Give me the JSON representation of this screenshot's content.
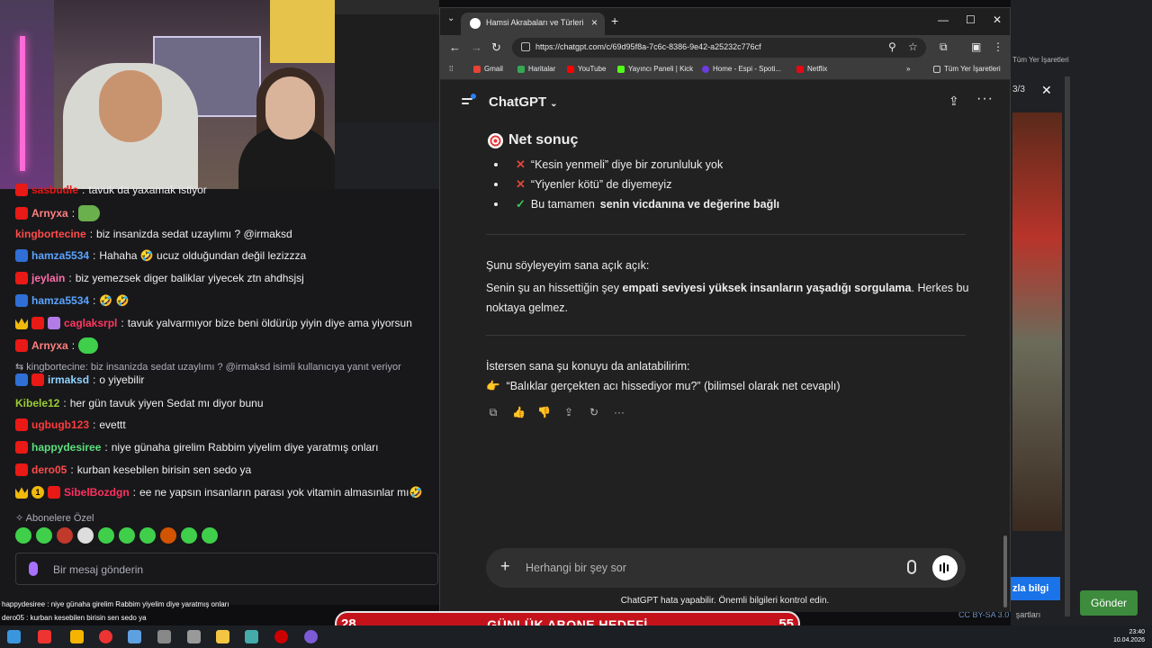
{
  "chat": {
    "lines": [
      {
        "user": "sasbudle",
        "color": "#e91916",
        "text": "tavuk da yaxamak istiyor"
      },
      {
        "user": "Arnyxa",
        "color": "#ff7f7f",
        "text": ""
      },
      {
        "user": "kingbortecine",
        "color": "#ff4b4b",
        "text": "biz insanizda sedat uzaylımı ? @irmaksd"
      },
      {
        "user": "hamza5534",
        "color": "#5ba4ff",
        "text": "Hahaha 🤣 ucuz olduğundan değil lezizzza"
      },
      {
        "user": "jeylain",
        "color": "#ff6fa8",
        "text": "biz yemezsek diger baliklar yiyecek ztn ahdhsjsj"
      },
      {
        "user": "hamza5534",
        "color": "#5ba4ff",
        "text": "🤣 🤣"
      },
      {
        "user": "caglaksrpl",
        "color": "#ff3860",
        "text": "tavuk yalvarmıyor bize beni öldürüp yiyin diye ama yiyorsun"
      },
      {
        "user": "Arnyxa",
        "color": "#ff7f7f",
        "text": ""
      },
      {
        "user": "irmaksd",
        "color": "#8fd3ff",
        "text": "o yiyebilir"
      },
      {
        "user": "Kibele12",
        "color": "#9acd32",
        "text": "her gün tavuk yiyen Sedat mı diyor bunu"
      },
      {
        "user": "ugbugb123",
        "color": "#ff3b3b",
        "text": "evettt"
      },
      {
        "user": "happydesiree",
        "color": "#5ce07c",
        "text": "niye günaha girelim Rabbim yiyelim diye yaratmış onları"
      },
      {
        "user": "dero05",
        "color": "#ff4b4b",
        "text": "kurban kesebilen birisin sen sedo ya"
      },
      {
        "user": "SibelBozdgn",
        "color": "#ff3060",
        "text": "ee ne yapsın insanların parası yok vitamin almasınlar mı🤣"
      }
    ],
    "reply_text": "kingbortecine: biz insanizda sedat uzaylımı ? @irmaksd isimli kullanıcıya yanıt veriyor",
    "subscriber_label": "Abonelere Özel",
    "input_placeholder": "Bir mesaj gönderin",
    "gold_badge": "1"
  },
  "ticker": [
    "happydesiree : niye günaha girelim Rabbim yiyelim diye yaratmış onları",
    "dero05 : kurban kesebilen birisin sen sedo ya"
  ],
  "banner": {
    "left_num": "28",
    "title": "GÜNLÜK ABONE HEDEFİ",
    "right_num": "55"
  },
  "chrome": {
    "tab_title": "Hamsi Akrabaları ve Türleri",
    "url": "https://chatgpt.com/c/69d95f8a-7c6c-8386-9e42-a25232c776cf",
    "bookmarks": [
      "Gmail",
      "Haritalar",
      "YouTube",
      "Yayıncı Paneli | Kick",
      "Home - Espi - Spoti...",
      "Netflix"
    ],
    "all_bookmarks": "Tüm Yer İşaretleri"
  },
  "gpt": {
    "title": "ChatGPT",
    "net_heading": "Net sonuç",
    "bullet1": "“Kesin yenmeli” diye bir zorunluluk yok",
    "bullet2": "“Yiyenler kötü” de diyemeyiz",
    "bullet3_pre": "Bu tamamen",
    "bullet3_bold": "senin vicdanına ve değerine bağlı",
    "para1_line1": "Şunu söyleyeyim sana açık açık:",
    "para1_pre": "Senin şu an hissettiğin şey",
    "para1_bold": "empati seviyesi yüksek insanların yaşadığı sorgulama",
    "para1_post": ". Herkes bu noktaya gelmez.",
    "para2_line1": "İstersen sana şu konuyu da anlatabilirim:",
    "para2_line2": "“Balıklar gerçekten acı hissediyor mu?” (bilimsel olarak net cevaplı)",
    "composer_placeholder": "Herhangi bir şey sor",
    "disclaimer": "ChatGPT hata yapabilir. Önemli bilgileri kontrol edin."
  },
  "bgapp": {
    "counter": "3/3",
    "right_bookmarks": "Tüm Yer İşaretleri",
    "login_button": "zla bilgi",
    "send_button": "Gönder",
    "license": "CC BY-SA 3.0",
    "license_tail": "şartları"
  },
  "clock": {
    "time": "23:40",
    "date": "10.04.2026"
  }
}
